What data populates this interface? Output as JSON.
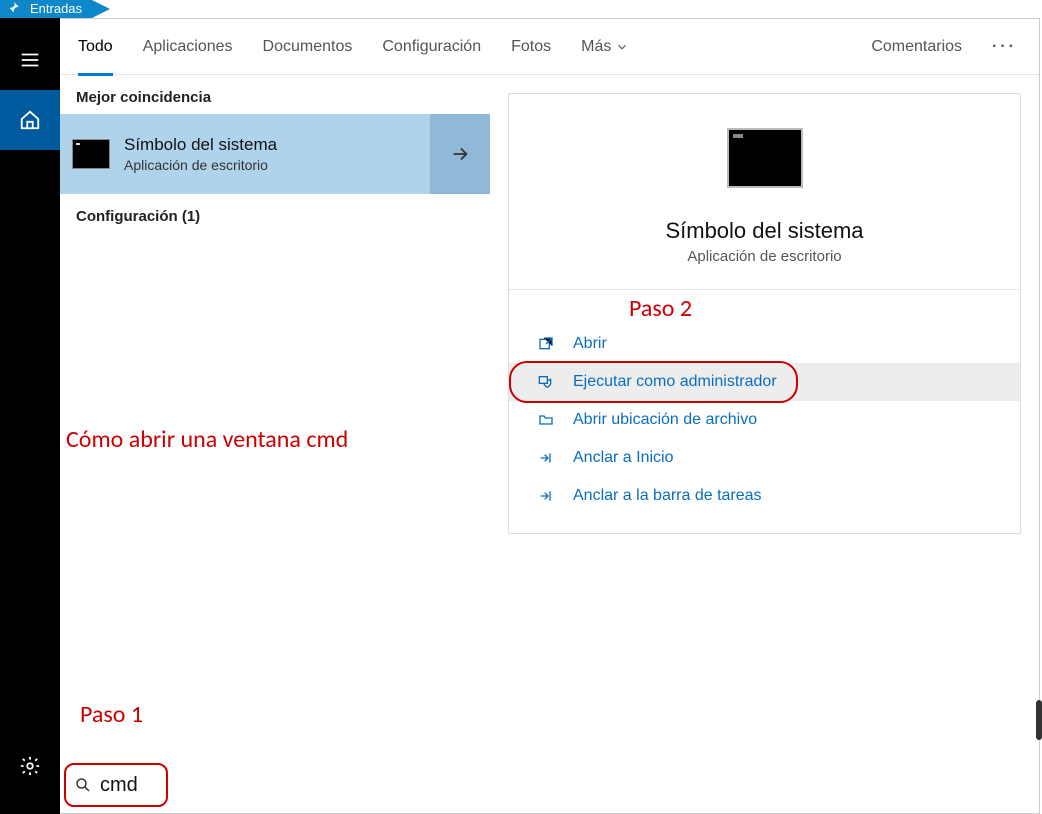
{
  "top_tab": {
    "label": "Entradas"
  },
  "rail": {
    "hamburger": "menu-icon",
    "home": "home-icon",
    "gear": "gear-icon"
  },
  "filters": {
    "todo": "Todo",
    "aplicaciones": "Aplicaciones",
    "documentos": "Documentos",
    "configuracion": "Configuración",
    "fotos": "Fotos",
    "mas": "Más",
    "comentarios": "Comentarios"
  },
  "results": {
    "section_header": "Mejor coincidencia",
    "best_match": {
      "title": "Símbolo del sistema",
      "subtitle": "Aplicación de escritorio"
    },
    "config_header": "Configuración (1)"
  },
  "detail": {
    "title": "Símbolo del sistema",
    "subtitle": "Aplicación de escritorio",
    "actions": {
      "open": "Abrir",
      "run_admin": "Ejecutar como administrador",
      "open_location": "Abrir ubicación de archivo",
      "pin_start": "Anclar a Inicio",
      "pin_taskbar": "Anclar a la barra de tareas"
    }
  },
  "annotations": {
    "howto": "Cómo abrir una ventana cmd",
    "step1": "Paso 1",
    "step2": "Paso 2"
  },
  "search": {
    "value": "cmd"
  }
}
